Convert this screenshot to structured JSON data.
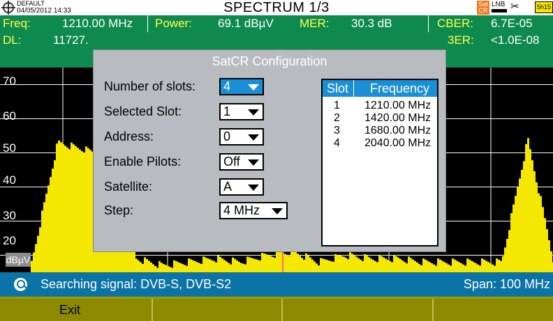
{
  "titlebar": {
    "profile": "DEFAULT",
    "datetime": "04/05/2012 14:33",
    "title": "SPECTRUM 1/3",
    "sat_badge_line1": "Sat",
    "sat_badge_line2": "CR",
    "lnb_label": "LNB",
    "battery_label": "5h15"
  },
  "measurements": {
    "row1": [
      {
        "label": "Freq:",
        "value": "1210.00 MHz"
      },
      {
        "label": "Power:",
        "value": "69.1 dBµV"
      },
      {
        "label": "MER:",
        "value": "30.3 dB"
      },
      {
        "label": "CBER:",
        "value": "6.7E-05"
      }
    ],
    "row2": [
      {
        "label": "DL:",
        "value": "11727."
      },
      {
        "label": "3ER:",
        "value": "<1.0E-08"
      }
    ]
  },
  "plot": {
    "y_ticks": [
      "70",
      "60",
      "50",
      "40",
      "30",
      "20"
    ],
    "unit": "dBµV",
    "colors": {
      "trace": "#f5e800",
      "grid": "#ffffff",
      "marker": "#ff6a6a"
    }
  },
  "chart_data": {
    "type": "area",
    "ylim": [
      15,
      75
    ],
    "ylabel": "dBµV",
    "yticks": [
      70,
      60,
      50,
      40,
      30,
      20
    ],
    "x_span_mhz": 100,
    "x": [
      0,
      5,
      10,
      15,
      20,
      25,
      30,
      35,
      40,
      45,
      50,
      55,
      60,
      65,
      70,
      75,
      80,
      85,
      90,
      95,
      100
    ],
    "values": [
      18,
      53,
      51,
      49,
      19,
      17,
      18,
      19,
      18,
      20,
      21,
      18,
      20,
      19,
      19,
      18,
      18,
      18,
      18,
      54,
      18
    ]
  },
  "dialog": {
    "title": "SatCR Configuration",
    "fields": [
      {
        "label": "Number of slots:",
        "value": "4",
        "focused": true
      },
      {
        "label": "Selected Slot:",
        "value": "1"
      },
      {
        "label": "Address:",
        "value": "0"
      },
      {
        "label": "Enable Pilots:",
        "value": "Off"
      },
      {
        "label": "Satellite:",
        "value": "A"
      },
      {
        "label": "Step:",
        "value": "4 MHz"
      }
    ],
    "table": {
      "headers": [
        "Slot",
        "Frequency"
      ],
      "rows": [
        [
          "1",
          "1210.00 MHz"
        ],
        [
          "2",
          "1420.00 MHz"
        ],
        [
          "3",
          "1680.00 MHz"
        ],
        [
          "4",
          "2040.00 MHz"
        ]
      ]
    }
  },
  "status": {
    "text": "Searching signal: DVB-S, DVB-S2",
    "span": "Span: 100 MHz"
  },
  "softkeys": [
    "Exit",
    "",
    "",
    ""
  ]
}
